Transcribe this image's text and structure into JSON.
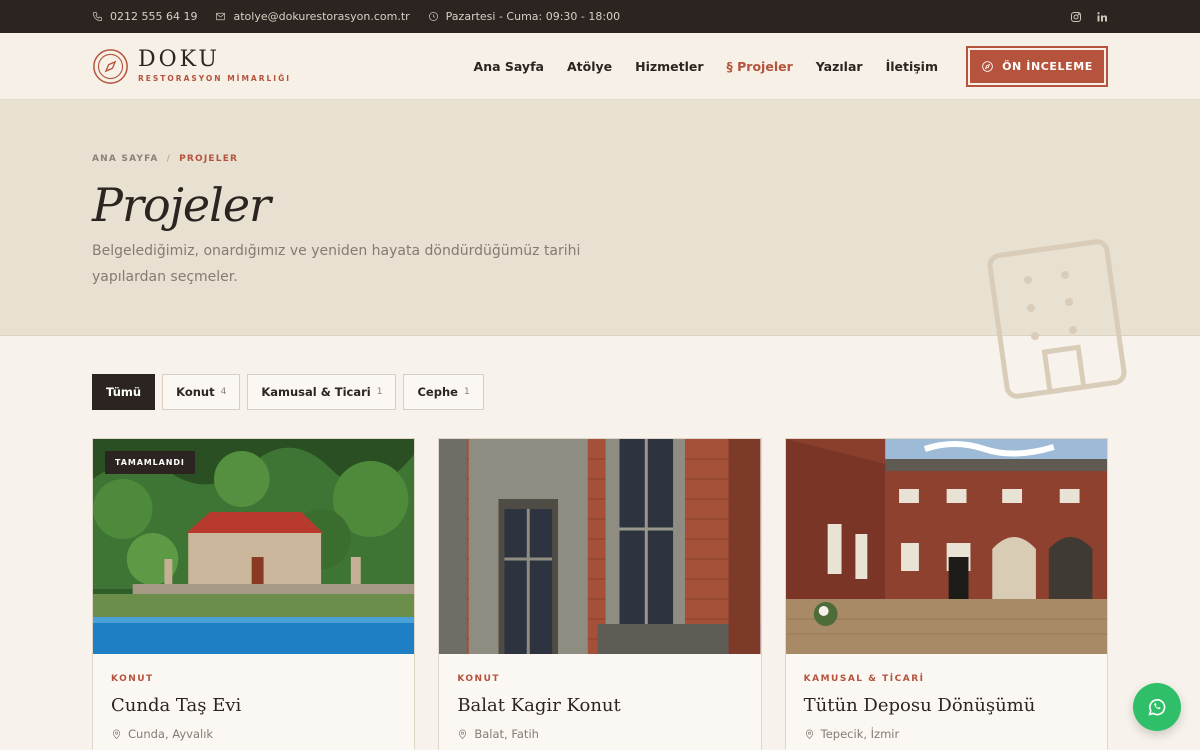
{
  "topbar": {
    "phone": "0212 555 64 19",
    "email": "atolye@dokurestorasyon.com.tr",
    "hours": "Pazartesi - Cuma: 09:30 - 18:00",
    "social": [
      "instagram-icon",
      "linkedin-icon"
    ]
  },
  "logo": {
    "name": "DOKU",
    "subtitle": "RESTORASYON MİMARLIĞI"
  },
  "nav": {
    "items": [
      {
        "label": "Ana Sayfa"
      },
      {
        "label": "Atölye"
      },
      {
        "label": "Hizmetler"
      },
      {
        "label": "§ Projeler",
        "active": true
      },
      {
        "label": "Yazılar"
      },
      {
        "label": "İletişim"
      }
    ],
    "cta": "ÖN İNCELEME"
  },
  "hero": {
    "breadcrumb": {
      "home": "ANA SAYFA",
      "sep": "/",
      "current": "PROJELER"
    },
    "title": "Projeler",
    "description": "Belgelediğimiz, onardığımız ve yeniden hayata döndürdüğümüz tarihi yapılardan seçmeler."
  },
  "filters": [
    {
      "label": "Tümü",
      "count": "",
      "active": true
    },
    {
      "label": "Konut",
      "count": "4"
    },
    {
      "label": "Kamusal & Ticari",
      "count": "1"
    },
    {
      "label": "Cephe",
      "count": "1"
    }
  ],
  "cards": [
    {
      "badge": "TAMAMLANDI",
      "category": "KONUT",
      "title": "Cunda Taş Evi",
      "location": "Cunda, Ayvalık"
    },
    {
      "badge": "",
      "category": "KONUT",
      "title": "Balat Kagir Konut",
      "location": "Balat, Fatih"
    },
    {
      "badge": "",
      "category": "KAMUSAL & TİCARİ",
      "title": "Tütün Deposu Dönüşümü",
      "location": "Tepecik, İzmir"
    }
  ],
  "colors": {
    "accent": "#b5533c",
    "dark": "#2b2420",
    "whatsapp": "#2fbf68"
  }
}
